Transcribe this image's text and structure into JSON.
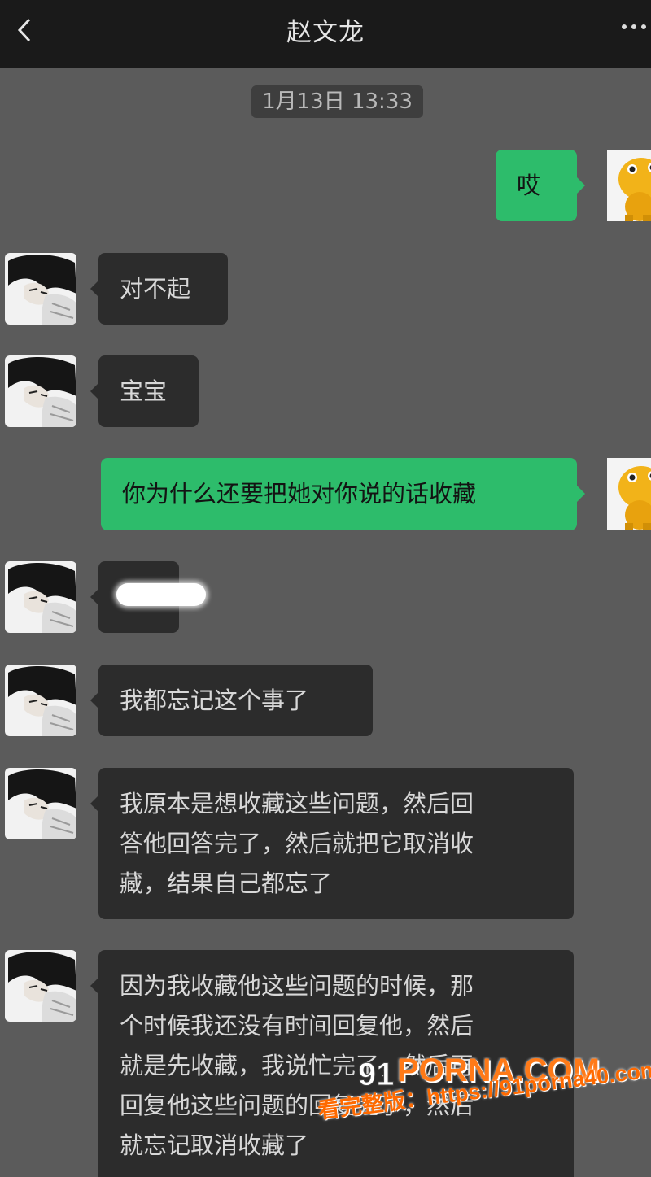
{
  "header": {
    "title": "赵文龙",
    "back_icon": "chevron-left-icon",
    "more_icon": "more-icon"
  },
  "chat": {
    "timestamp": "1月13日 13:33",
    "messages": [
      {
        "side": "right",
        "text": "哎"
      },
      {
        "side": "left",
        "text": "对不起"
      },
      {
        "side": "left",
        "text": "宝宝"
      },
      {
        "side": "right",
        "text": "你为什么还要把她对你说的话收藏"
      },
      {
        "side": "left",
        "text": ""
      },
      {
        "side": "left",
        "text": "我都忘记这个事了"
      },
      {
        "side": "left",
        "lines": [
          "我原本是想收藏这些问题，然后回",
          "答他回答完了，然后就把它取消收",
          "藏，结果自己都忘了"
        ]
      },
      {
        "side": "left",
        "lines": [
          "因为我收藏他这些问题的时候，那",
          "个时候我还没有时间回复他，然后",
          "就是先收藏，我说忙完了，然后再",
          "回复他这些问题的回复完了，然后",
          "就忘记取消收藏了"
        ]
      }
    ]
  },
  "watermark": {
    "brand": "PORNA.COM",
    "note": "看完整版：https://91porna40.com"
  },
  "colors": {
    "background": "#5b5b5b",
    "header": "#1a1a1a",
    "bubble_in": "#2c2c2c",
    "bubble_out": "#2dbc6b",
    "watermark": "#ff7a18"
  }
}
